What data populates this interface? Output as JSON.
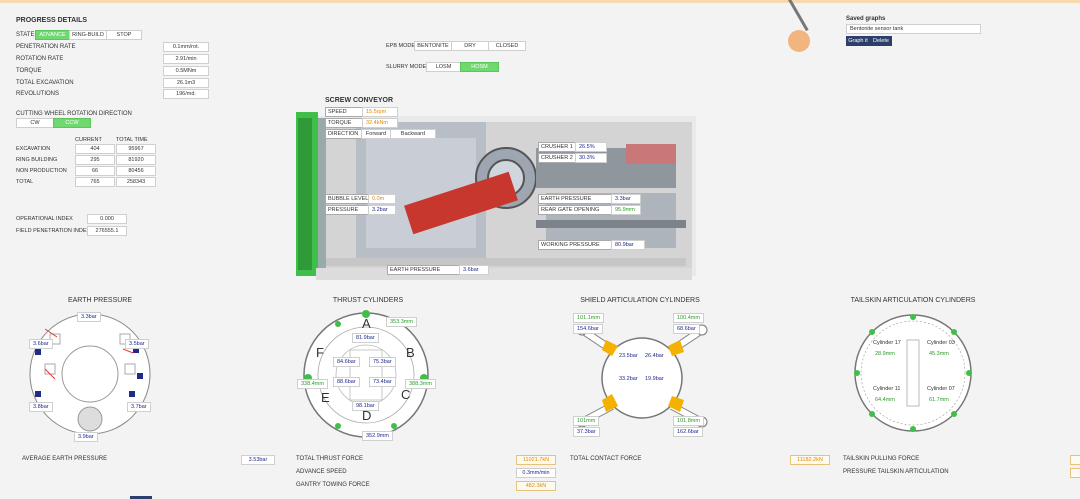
{
  "colors": {
    "accent_green": "#6fd96f",
    "value_blue": "#1e2a8c",
    "value_green": "#2a9a2a",
    "value_orange": "#e08a00"
  },
  "progress": {
    "title": "PROGRESS DETAILS",
    "state_label": "STATE",
    "state_buttons": [
      "ADVANCE",
      "RING-BUILD",
      "STOP"
    ],
    "rows": [
      {
        "label": "PENETRATION RATE",
        "value": "0.1mm/rot."
      },
      {
        "label": "ROTATION RATE",
        "value": "2.91/min"
      },
      {
        "label": "TORQUE",
        "value": "0.5MNm"
      },
      {
        "label": "TOTAL EXCAVATION",
        "value": "26.1m3"
      },
      {
        "label": "REVOLUTIONS",
        "value": "196/md."
      }
    ],
    "cw_title": "CUTTING WHEEL ROTATION DIRECTION",
    "cw_buttons": [
      "CW",
      "CCW"
    ],
    "time_headers": [
      "CURRENT",
      "TOTAL TIME"
    ],
    "time_rows": [
      {
        "label": "EXCAVATION",
        "current": "404",
        "total": "95967"
      },
      {
        "label": "RING BUILDING",
        "current": "295",
        "total": "81920"
      },
      {
        "label": "NON PRODUCTION",
        "current": "66",
        "total": "80456"
      },
      {
        "label": "TOTAL",
        "current": "765",
        "total": "258343"
      }
    ],
    "op_index_label": "OPERATIONAL INDEX",
    "op_index_value": "0.000",
    "fpi_label": "FIELD PENETRATION INDEX",
    "fpi_value": "276555.1"
  },
  "modes": {
    "epb_label": "EPB MODE",
    "epb_buttons": [
      "BENTONITE",
      "DRY",
      "CLOSED"
    ],
    "slurry_label": "SLURRY MODE",
    "slurry_buttons": [
      "LOSM",
      "HOSM"
    ]
  },
  "screw": {
    "title": "SCREW CONVEYOR",
    "speed_label": "SPEED",
    "speed_value": "15.5rpm",
    "torque_label": "TORQUE",
    "torque_value": "32.4kNm",
    "direction_label": "DIRECTION",
    "direction_buttons": [
      "Forward",
      "Backward"
    ],
    "bubble_label": "BUBBLE LEVEL",
    "bubble_value": "0.0m",
    "pressure_label": "PRESSURE",
    "pressure_value": "3.2bar",
    "crusher1_label": "CRUSHER 1",
    "crusher1_value": "26.5%",
    "crusher2_label": "CRUSHER 2",
    "crusher2_value": "30.3%",
    "earth_label": "EARTH PRESSURE",
    "earth_value": "3.3bar",
    "gate_label": "REAR GATE OPENING",
    "gate_value": "95.9mm",
    "working_label": "WORKING PRESSURE",
    "working_value": "80.9bar",
    "earth2_label": "EARTH PRESSURE",
    "earth2_value": "3.6bar"
  },
  "saved": {
    "title": "Saved graphs",
    "selected": "Bentonite sensor tank",
    "graph_button": "Graph it",
    "delete_button": "Delete"
  },
  "earth_pressure": {
    "title": "EARTH PRESSURE",
    "values": [
      "3.3bar",
      "3.6bar",
      "3.5bar",
      "3.8bar",
      "3.7bar",
      "3.9bar"
    ],
    "avg_label": "AVERAGE EARTH PRESSURE",
    "avg_value": "3.53bar"
  },
  "thrust": {
    "title": "THRUST CYLINDERS",
    "groups": [
      "A",
      "B",
      "C",
      "D",
      "E",
      "F"
    ],
    "pressures": [
      "81.9bar",
      "84.6bar",
      "75.3bar",
      "88.6bar",
      "73.4bar",
      "98.1bar"
    ],
    "strokes": [
      "353.3mm",
      "338.4mm",
      "388.3mm",
      "352.9mm"
    ],
    "total_force_label": "TOTAL THRUST FORCE",
    "total_force_value": "11021.7kN",
    "advance_label": "ADVANCE SPEED",
    "advance_value": "0.3mm/min",
    "gantry_label": "GANTRY TOWING FORCE",
    "gantry_value": "482.3kN"
  },
  "shield": {
    "title": "SHIELD ARTICULATION CYLINDERS",
    "strokes": [
      "101.1mm",
      "100.4mm",
      "101mm",
      "101.8mm"
    ],
    "pressures": [
      "154.6bar",
      "68.6bar",
      "37.3bar",
      "162.6bar"
    ],
    "inner": [
      "23.5bar",
      "26.4bar",
      "33.2bar",
      "19.9bar"
    ],
    "contact_label": "TOTAL CONTACT FORCE",
    "contact_value": "11182.2kN"
  },
  "tailskin": {
    "title": "TAILSKIN ARTICULATION CYLINDERS",
    "cyl_labels": [
      "Cylinder 17",
      "Cylinder 03",
      "Cylinder 11",
      "Cylinder 07"
    ],
    "cyl_values": [
      "28.9mm",
      "45.3mm",
      "64.4mm",
      "61.7mm"
    ],
    "pulling_label": "TAILSKIN PULLING FORCE",
    "pressure_label": "PRESSURE TAILSKIN ARTICULATION"
  }
}
